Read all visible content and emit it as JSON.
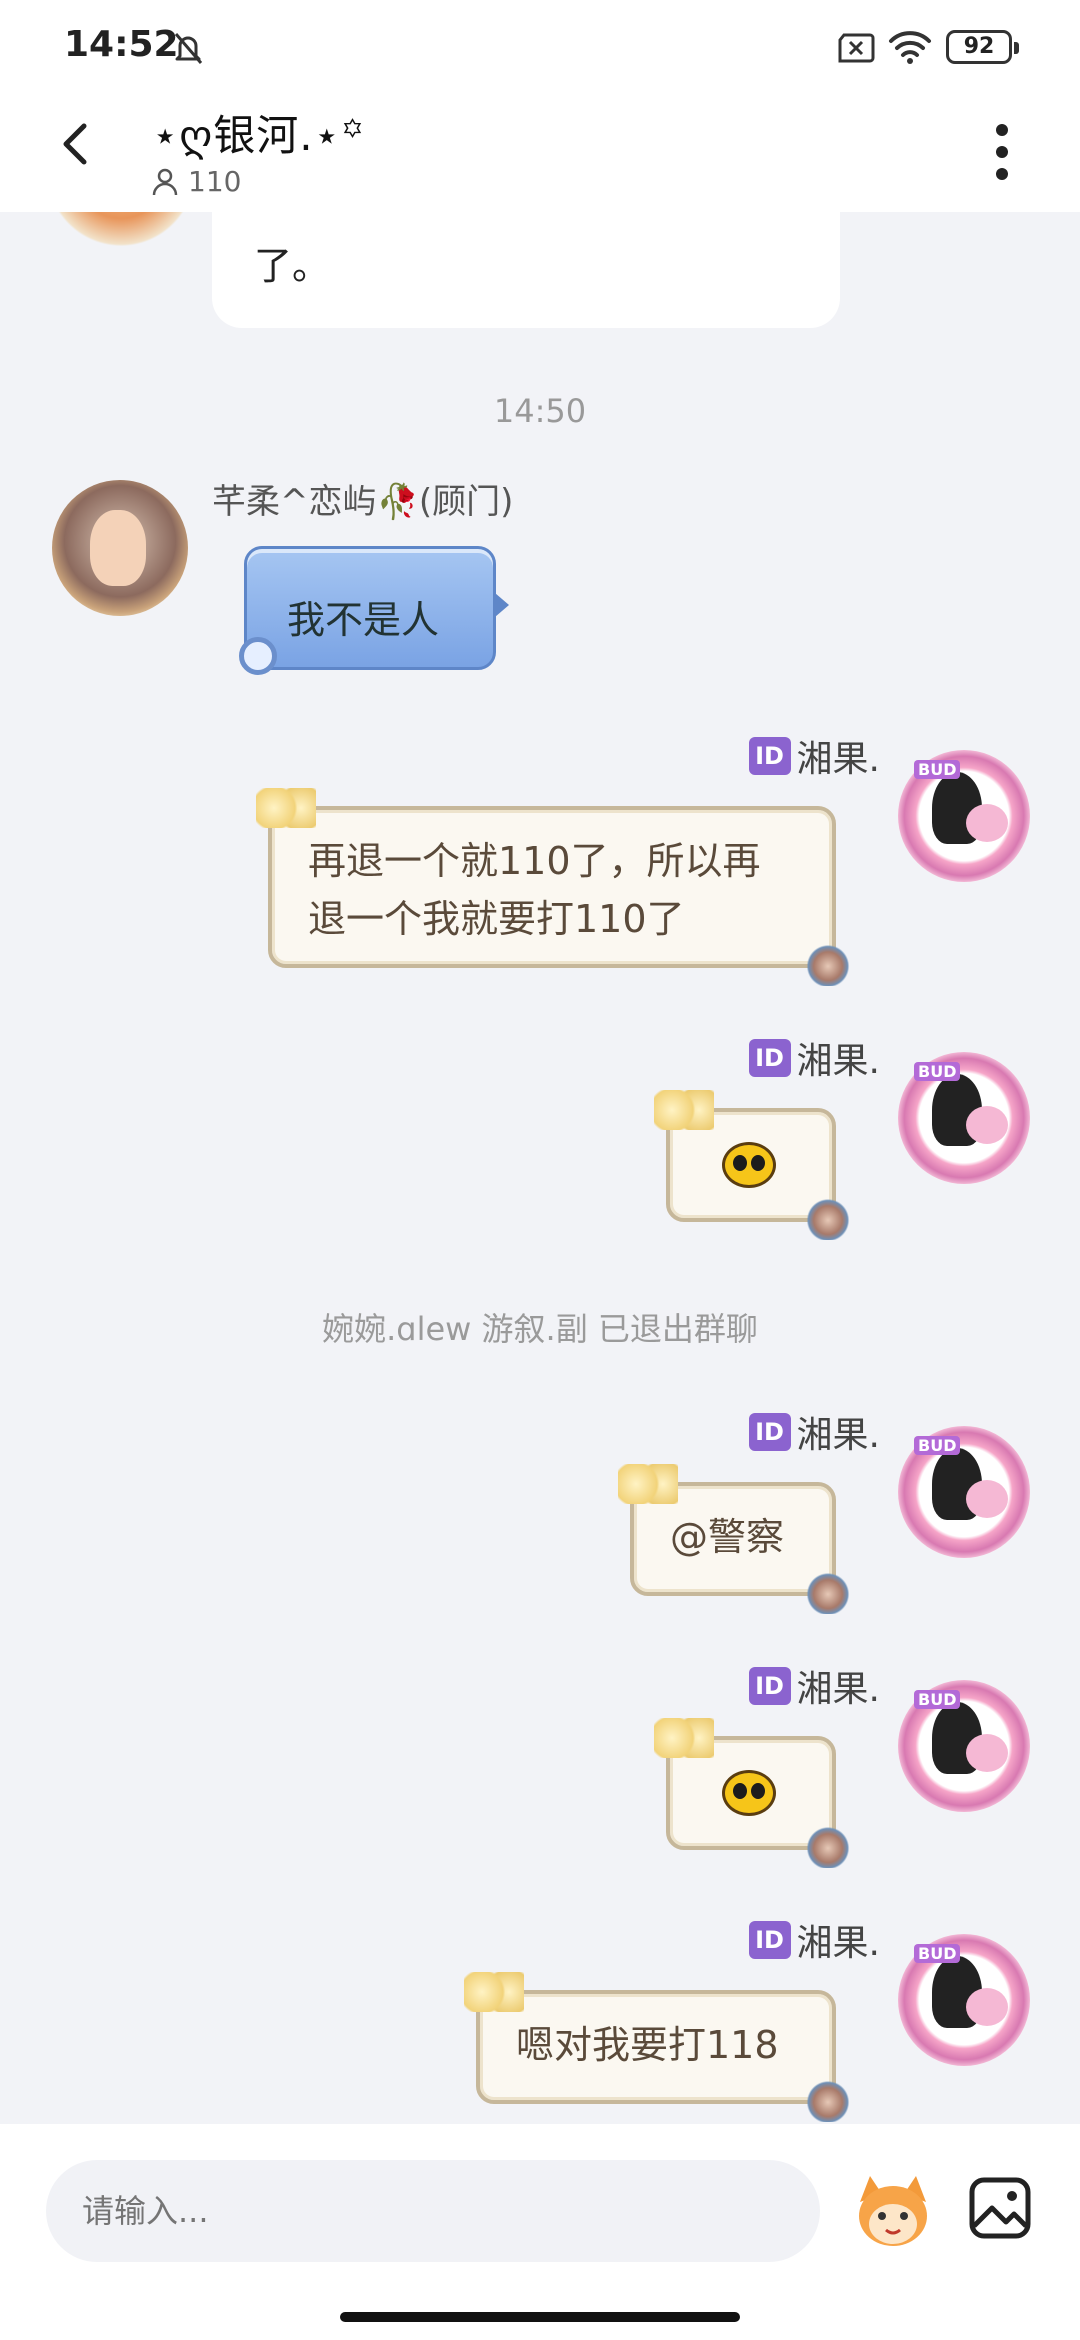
{
  "status_bar": {
    "time": "14:52",
    "battery": "92"
  },
  "header": {
    "title": "⋆ღ银河.⋆꙳",
    "member_count": "110"
  },
  "chat": {
    "partial_message": "了。",
    "timestamp": "14:50",
    "messages": [
      {
        "sender": "芊柔^恋屿🥀(顾门)",
        "text": "我不是人",
        "side": "left"
      },
      {
        "sender": "湘果.",
        "badge": "ID",
        "text_line1": "再退一个就110了，所以再",
        "text_line2": "退一个我就要打110了",
        "side": "right"
      },
      {
        "sender": "湘果.",
        "badge": "ID",
        "sticker": "emoji-face",
        "side": "right"
      },
      {
        "sender": "湘果.",
        "badge": "ID",
        "text": "@警察",
        "side": "right"
      },
      {
        "sender": "湘果.",
        "badge": "ID",
        "sticker": "emoji-face",
        "side": "right"
      },
      {
        "sender": "湘果.",
        "badge": "ID",
        "text": "嗯对我要打118",
        "side": "right"
      }
    ],
    "system_notice": "婉婉.ɑlew 游叙.副 已退出群聊"
  },
  "input": {
    "placeholder": "请输入..."
  },
  "icons": {
    "back": "back-arrow-icon",
    "more": "more-vertical-icon",
    "mascot": "mascot-icon",
    "image": "image-icon"
  },
  "colors": {
    "background": "#f2f3f7",
    "id_badge": "#8b63cf",
    "blue_bubble": "#7aa3e4"
  }
}
